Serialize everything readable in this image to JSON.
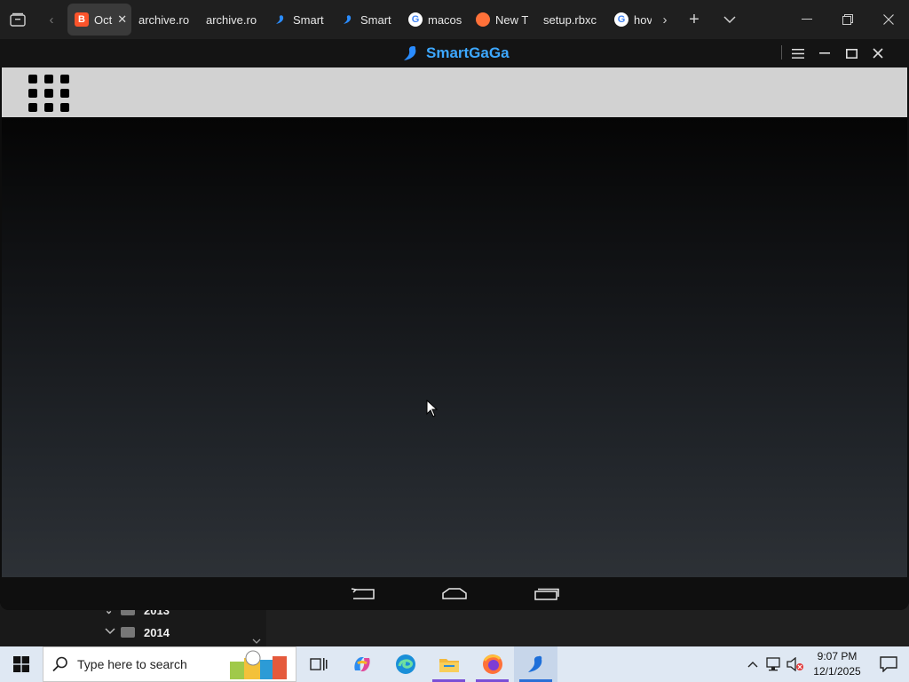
{
  "browser": {
    "tabs": [
      {
        "label": "Oct",
        "icon": "brave-icon",
        "active": true
      },
      {
        "label": "archive.ro",
        "icon": "none"
      },
      {
        "label": "archive.ro",
        "icon": "none"
      },
      {
        "label": "Smart",
        "icon": "smartgaga-icon"
      },
      {
        "label": "Smart",
        "icon": "smartgaga-icon"
      },
      {
        "label": "macos",
        "icon": "google-icon"
      },
      {
        "label": "New T",
        "icon": "firefox-icon"
      },
      {
        "label": "setup.rbxc",
        "icon": "none"
      },
      {
        "label": "hov",
        "icon": "google-icon"
      }
    ]
  },
  "explorer": {
    "rows": [
      {
        "label": "2013"
      },
      {
        "label": "2014"
      }
    ]
  },
  "emulator": {
    "app_name": "SmartGaGa",
    "accent": "#3da8ff"
  },
  "taskbar": {
    "search_placeholder": "Type here to search",
    "clock_time": "9:07 PM",
    "clock_date": "12/1/2025"
  }
}
